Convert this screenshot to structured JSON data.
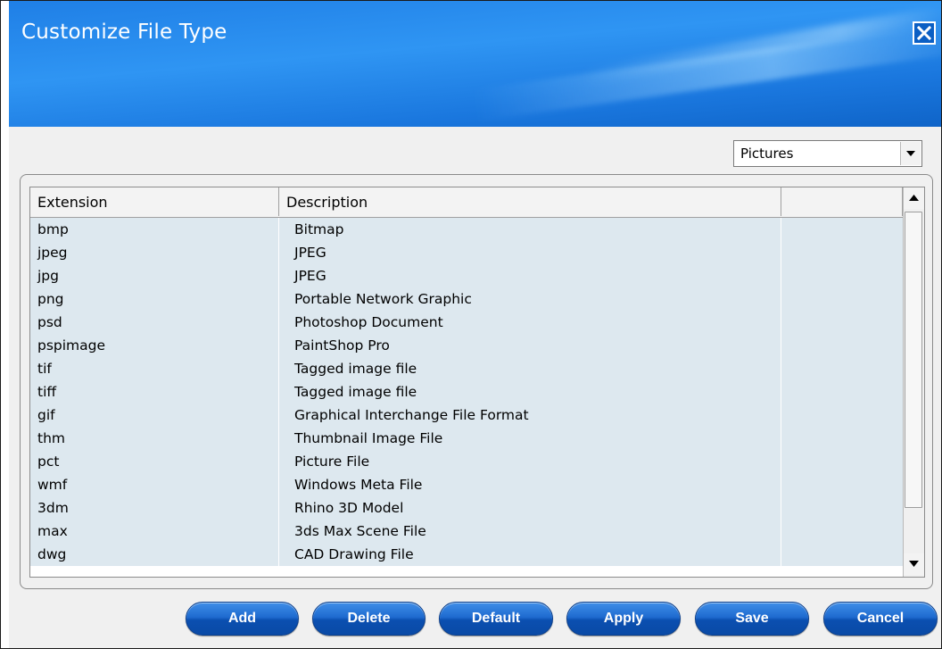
{
  "window": {
    "title": "Customize File Type"
  },
  "filter": {
    "selected": "Pictures"
  },
  "table": {
    "columns": [
      "Extension",
      "Description",
      ""
    ],
    "rows": [
      {
        "ext": "bmp",
        "desc": "Bitmap"
      },
      {
        "ext": "jpeg",
        "desc": "JPEG"
      },
      {
        "ext": "jpg",
        "desc": "JPEG"
      },
      {
        "ext": "png",
        "desc": "Portable Network Graphic"
      },
      {
        "ext": "psd",
        "desc": "Photoshop Document"
      },
      {
        "ext": "pspimage",
        "desc": "PaintShop Pro"
      },
      {
        "ext": "tif",
        "desc": "Tagged image file"
      },
      {
        "ext": "tiff",
        "desc": "Tagged image file"
      },
      {
        "ext": "gif",
        "desc": "Graphical Interchange File Format"
      },
      {
        "ext": "thm",
        "desc": "Thumbnail Image File"
      },
      {
        "ext": "pct",
        "desc": "Picture File"
      },
      {
        "ext": "wmf",
        "desc": "Windows Meta File"
      },
      {
        "ext": "3dm",
        "desc": "Rhino 3D Model"
      },
      {
        "ext": "max",
        "desc": "3ds Max Scene File"
      },
      {
        "ext": "dwg",
        "desc": "CAD Drawing File"
      }
    ]
  },
  "buttons": {
    "add": "Add",
    "delete": "Delete",
    "default": "Default",
    "apply": "Apply",
    "save": "Save",
    "cancel": "Cancel"
  },
  "colors": {
    "titlebar": "#1f80e6",
    "button": "#1f6bd0",
    "row_bg": "#dde8ef"
  },
  "icons": {
    "close": "close-icon",
    "dropdown": "chevron-down-icon",
    "scroll_up": "scroll-up-arrow-icon",
    "scroll_down": "scroll-down-arrow-icon"
  }
}
